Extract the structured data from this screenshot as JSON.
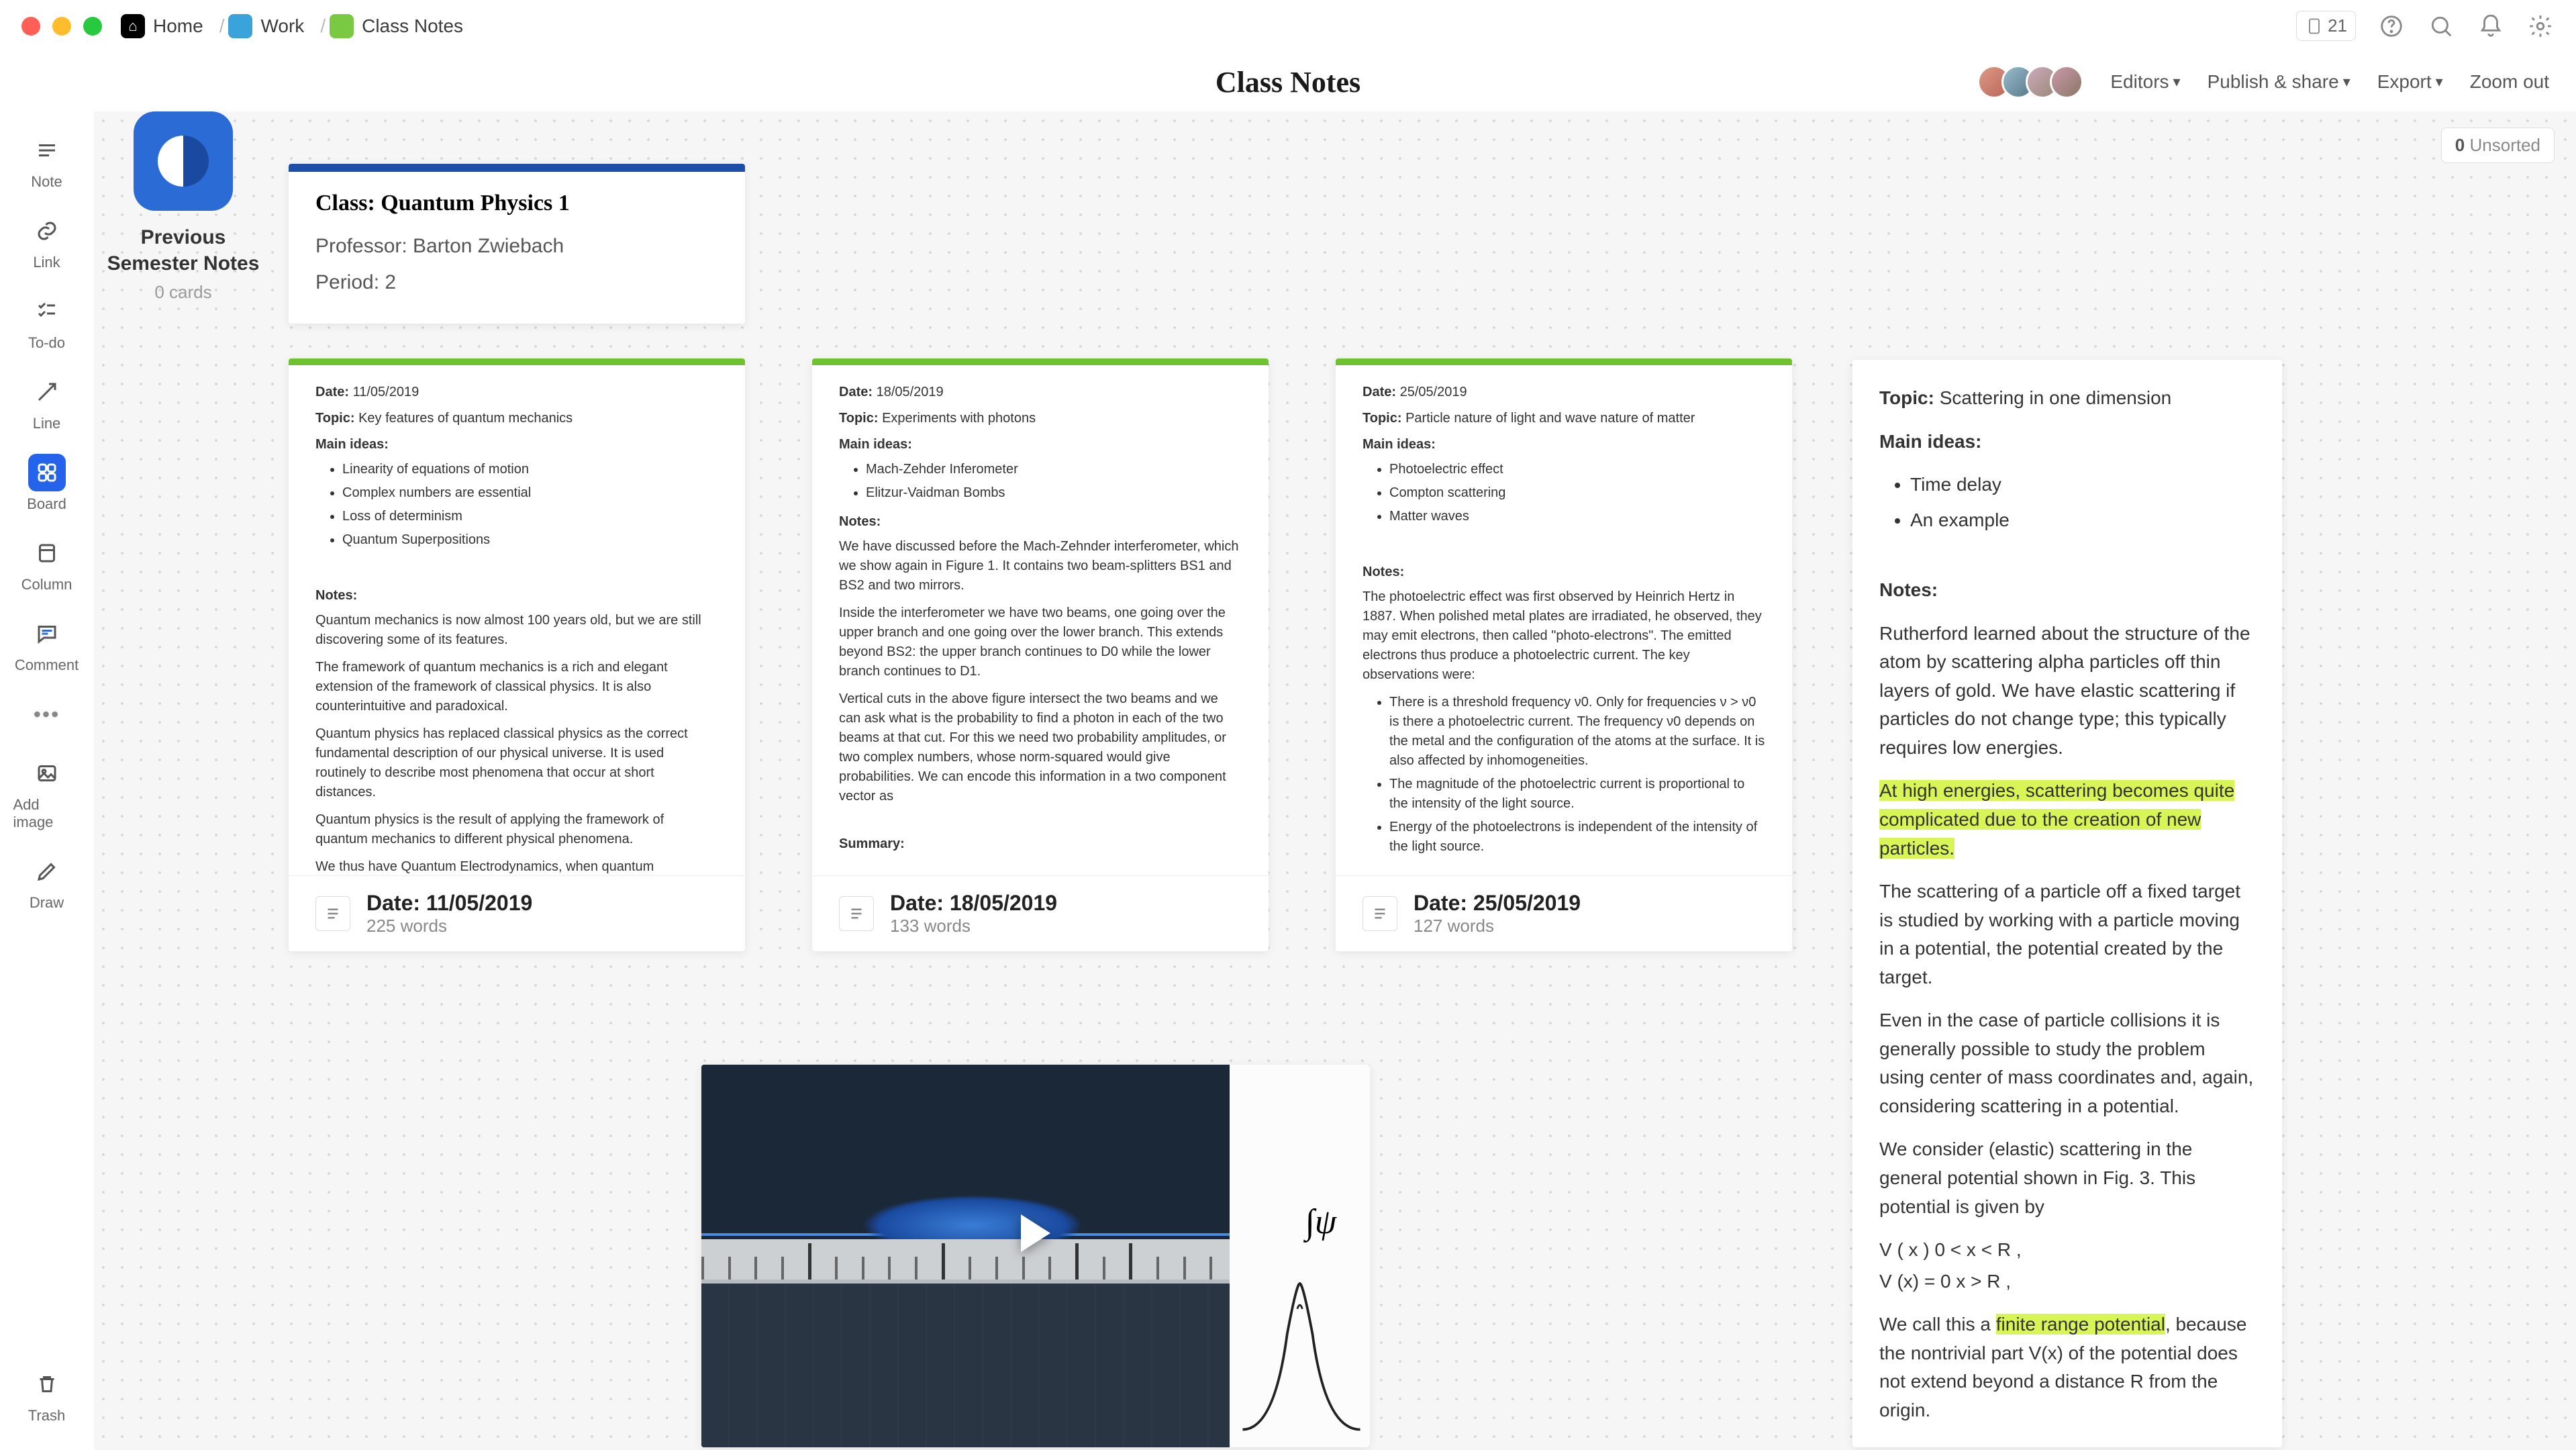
{
  "breadcrumb": {
    "home": "Home",
    "work": "Work",
    "notes": "Class Notes"
  },
  "titlebar": {
    "device_count": "21"
  },
  "page": {
    "title": "Class Notes"
  },
  "secondbar": {
    "editors": "Editors",
    "publish": "Publish & share",
    "export": "Export",
    "zoom_out": "Zoom out"
  },
  "tools": {
    "note": "Note",
    "link": "Link",
    "todo": "To-do",
    "line": "Line",
    "board": "Board",
    "column": "Column",
    "comment": "Comment",
    "add_image": "Add image",
    "draw": "Draw",
    "trash": "Trash"
  },
  "unsorted": {
    "count": "0",
    "label": "Unsorted"
  },
  "class_header": {
    "title": "Class: Quantum Physics 1",
    "professor": "Professor: Barton Zwiebach",
    "period": "Period: 2"
  },
  "notes": [
    {
      "date_label": "Date:",
      "date": "11/05/2019",
      "topic_label": "Topic:",
      "topic": "Key features of quantum mechanics",
      "ideas_label": "Main ideas:",
      "ideas": [
        "Linearity of equations of motion",
        "Complex numbers are essential",
        "Loss of determinism",
        "Quantum Superpositions"
      ],
      "notes_label": "Notes:",
      "paras": [
        "Quantum mechanics is now almost 100 years old, but we are still discovering some of its features.",
        "The framework of quantum mechanics is a rich and elegant extension of the framework of classical physics. It is also counterintuitive and paradoxical.",
        "Quantum physics has replaced classical physics as the correct fundamental description of our physical universe. It is used routinely to describe most phenomena that occur at short distances.",
        "Quantum physics is the result of applying the framework of quantum mechanics to different physical phenomena.",
        "We thus have Quantum Electrodynamics, when quantum mechanics is applied to electromagnetism, Quantum Optics, when it is applied to light"
      ],
      "footer_date": "Date: 11/05/2019",
      "footer_words": "225 words"
    },
    {
      "date_label": "Date:",
      "date": "18/05/2019",
      "topic_label": "Topic:",
      "topic": "Experiments with photons",
      "ideas_label": "Main ideas:",
      "ideas": [
        "Mach-Zehder Inferometer",
        "Elitzur-Vaidman Bombs"
      ],
      "notes_label": "Notes:",
      "paras": [
        "We have discussed before the Mach-Zehnder interferometer, which we show again in Figure 1. It contains two beam-splitters BS1 and BS2 and two mirrors.",
        "Inside the interferometer we have two beams, one going over the upper branch and one going over the lower branch. This extends beyond BS2: the upper branch continues to D0 while the lower branch continues to D1.",
        "Vertical cuts in the above figure intersect the two beams and we can ask what is the probability to find a photon in each of the two beams at that cut. For this we need two probability amplitudes, or two complex numbers, whose norm-squared would give probabilities. We can encode this information in a two component vector as"
      ],
      "summary_label": "Summary:",
      "footer_date": "Date: 18/05/2019",
      "footer_words": "133 words"
    },
    {
      "date_label": "Date:",
      "date": "25/05/2019",
      "topic_label": "Topic:",
      "topic": "Particle nature of light and wave nature of matter",
      "ideas_label": "Main ideas:",
      "ideas": [
        "Photoelectric effect",
        "Compton scattering",
        "Matter waves"
      ],
      "notes_label": "Notes:",
      "paras": [
        "The photoelectric effect was first observed by Heinrich Hertz in 1887. When polished metal plates are irradiated, he observed, they may emit electrons, then called \"photo-electrons\". The emitted electrons thus produce a photoelectric current. The key observations were:"
      ],
      "bullets": [
        "There is a threshold frequency ν0. Only for frequencies ν > ν0 is there a photoelectric current. The frequency ν0 depends on the metal and the configuration of the atoms at the surface. It is also affected by inhomogeneities.",
        "The magnitude of the photoelectric current is proportional to the intensity of the light source.",
        "Energy of the photoelectrons is independent of the intensity of the light source."
      ],
      "footer_date": "Date: 25/05/2019",
      "footer_words": "127 words"
    }
  ],
  "topic_card": {
    "topic_label": "Topic:",
    "topic": "Scattering in one dimension",
    "ideas_label": "Main ideas:",
    "ideas": [
      "Time delay",
      "An example"
    ],
    "notes_label": "Notes:",
    "p1": "Rutherford learned about the structure of the atom by scattering alpha particles off thin layers of gold. We have elastic scattering if particles do not change type; this typically requires low energies.",
    "p2": "At high energies, scattering becomes quite complicated due to the creation of new particles.",
    "p3": "The scattering of a particle off a fixed target is studied by working with a particle moving in a potential, the potential created by the target.",
    "p4": "Even in the case of particle collisions it is generally possible to study the problem using center of mass coordinates and, again, considering scattering in a potential.",
    "p5": "We consider (elastic) scattering in the general potential shown in Fig. 3. This potential is given by",
    "eq1": "V ( x ) 0 < x < R ,",
    "eq2": "V (x) = 0 x > R ,",
    "p6a": "We call this a ",
    "p6_hl": "finite range potential",
    "p6b": ", because the nontrivial part V(x) of the potential does not extend beyond a distance R from the origin."
  },
  "link_card": {
    "title": "Previous Semester Notes",
    "sub": "0 cards"
  },
  "video": {
    "integral": "∫ψ"
  }
}
